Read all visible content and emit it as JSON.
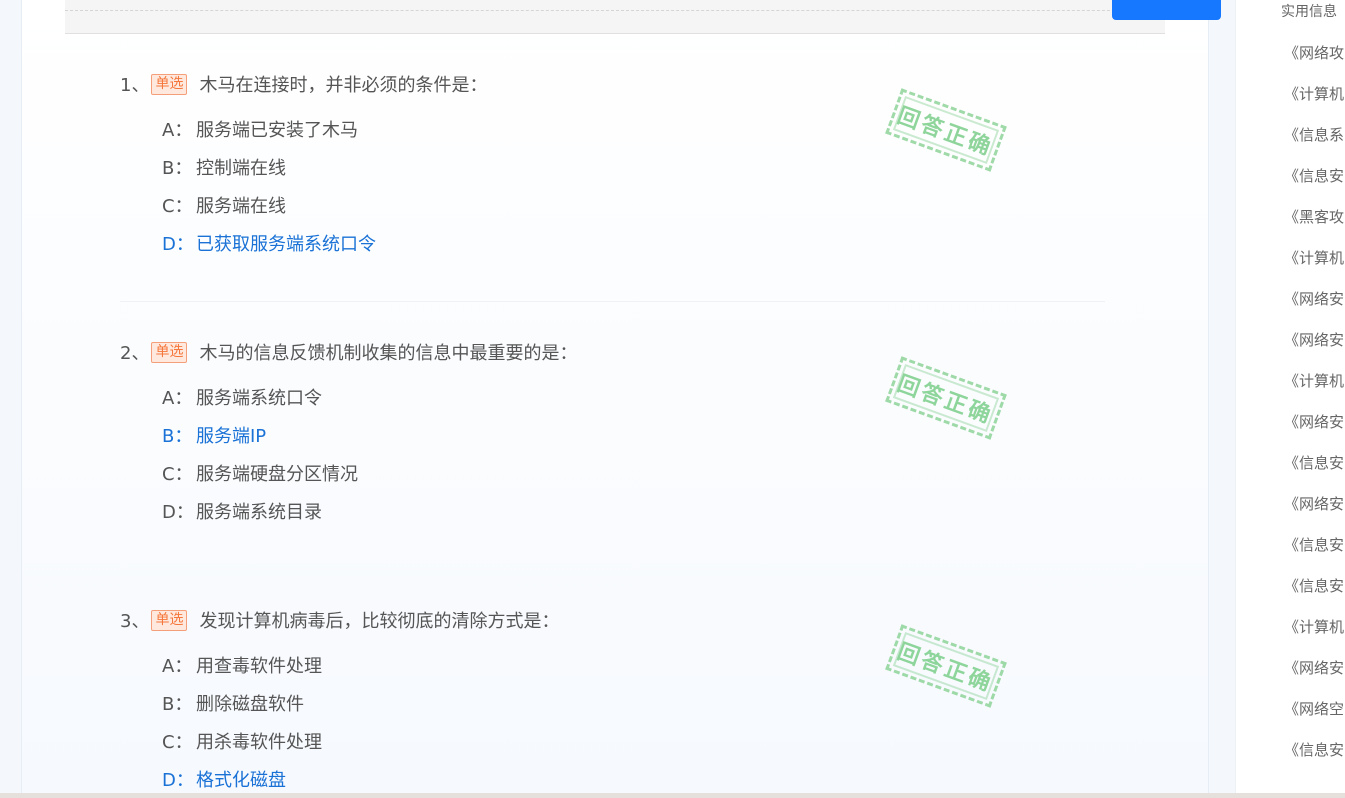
{
  "questions": [
    {
      "num": "1、",
      "tag": "单选",
      "text": "木马在连接时，并非必须的条件是：",
      "stamp": "回答正确",
      "options": [
        {
          "letter": "A：",
          "text": "服务端已安装了木马",
          "correct": false
        },
        {
          "letter": "B：",
          "text": "控制端在线",
          "correct": false
        },
        {
          "letter": "C：",
          "text": "服务端在线",
          "correct": false
        },
        {
          "letter": "D：",
          "text": "已获取服务端系统口令",
          "correct": true
        }
      ]
    },
    {
      "num": "2、",
      "tag": "单选",
      "text": "木马的信息反馈机制收集的信息中最重要的是：",
      "stamp": "回答正确",
      "options": [
        {
          "letter": "A：",
          "text": "服务端系统口令",
          "correct": false
        },
        {
          "letter": "B：",
          "text": "服务端IP",
          "correct": true
        },
        {
          "letter": "C：",
          "text": "服务端硬盘分区情况",
          "correct": false
        },
        {
          "letter": "D：",
          "text": "服务端系统目录",
          "correct": false
        }
      ]
    },
    {
      "num": "3、",
      "tag": "单选",
      "text": "发现计算机病毒后，比较彻底的清除方式是：",
      "stamp": "回答正确",
      "options": [
        {
          "letter": "A：",
          "text": "用查毒软件处理",
          "correct": false
        },
        {
          "letter": "B：",
          "text": "删除磁盘软件",
          "correct": false
        },
        {
          "letter": "C：",
          "text": "用杀毒软件处理",
          "correct": false
        },
        {
          "letter": "D：",
          "text": "格式化磁盘",
          "correct": true
        }
      ]
    }
  ],
  "sidebar": {
    "title": "实用信息",
    "items": [
      "《网络攻",
      "《计算机",
      "《信息系",
      "《信息安",
      "《黑客攻",
      "《计算机",
      "《网络安",
      "《网络安",
      "《计算机",
      "《网络安",
      "《信息安",
      "《网络安",
      "《信息安",
      "《信息安",
      "《计算机",
      "《网络安",
      "《网络空",
      "《信息安"
    ]
  },
  "colors": {
    "correct": "#1a72d6",
    "tag": "#f5773b",
    "stamp": "#7ccf8a",
    "accent": "#1677ff"
  }
}
